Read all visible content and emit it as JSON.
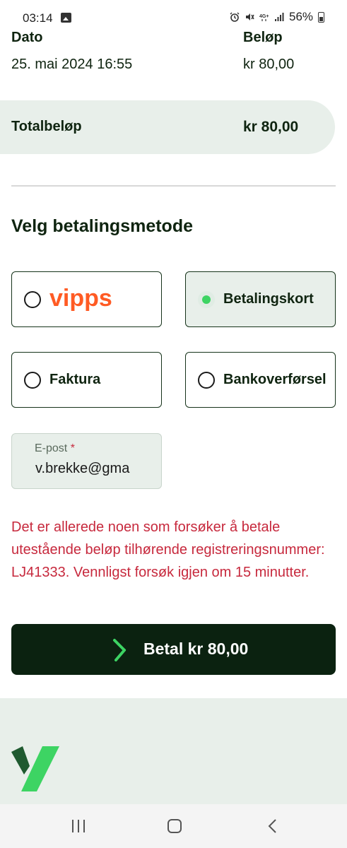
{
  "status_bar": {
    "time": "03:14",
    "battery": "56%"
  },
  "summary": {
    "headers": {
      "date": "Dato",
      "amount": "Beløp"
    },
    "row": {
      "date": "25. mai 2024 16:55",
      "amount": "kr 80,00"
    },
    "total": {
      "label": "Totalbeløp",
      "value": "kr 80,00"
    }
  },
  "payment": {
    "title": "Velg betalingsmetode",
    "options": [
      {
        "label": "vipps",
        "selected": false
      },
      {
        "label": "Betalingskort",
        "selected": true
      },
      {
        "label": "Faktura",
        "selected": false
      },
      {
        "label": "Bankoverførsel",
        "selected": false
      }
    ]
  },
  "email": {
    "label": "E-post",
    "required_mark": "*",
    "value": "v.brekke@gma"
  },
  "error": {
    "message": "Det er allerede noen som forsøker å betale utestående beløp tilhørende registreringsnummer: LJ41333. Vennligst forsøk igjen om 15 minutter."
  },
  "pay_button": {
    "label": "Betal kr 80,00"
  },
  "colors": {
    "brand_dark": "#0b2210",
    "brand_green": "#3dd463",
    "panel_bg": "#e8efea",
    "error": "#c7293d",
    "vipps_orange": "#ff5b24"
  },
  "icons": {
    "pay_chevron": "chevron-right-icon",
    "footer_logo": "brand-logo-icon",
    "nav_recent": "recent-apps-icon",
    "nav_home": "home-icon",
    "nav_back": "back-icon"
  }
}
